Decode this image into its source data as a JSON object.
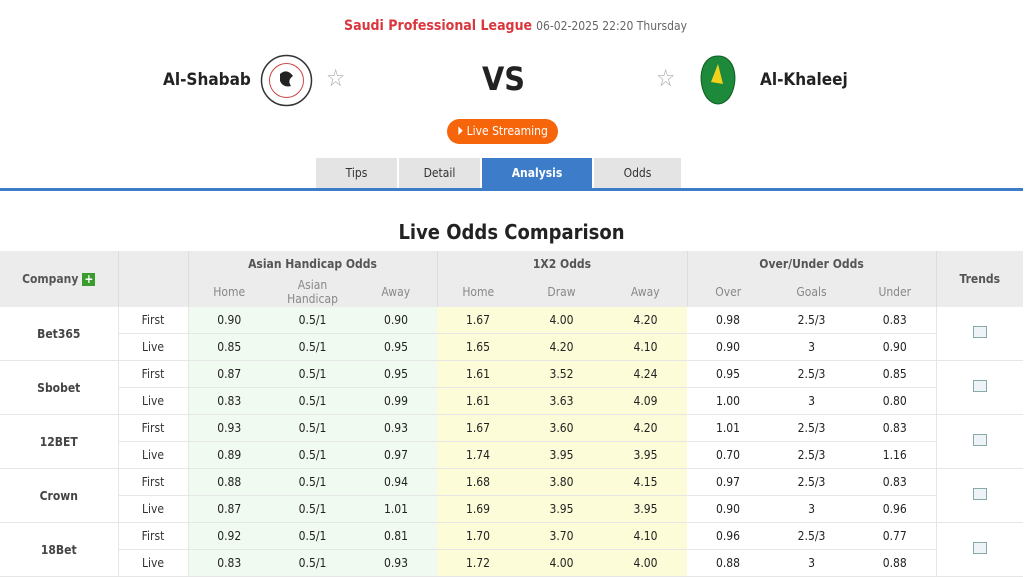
{
  "header": {
    "league": "Saudi Professional League",
    "datetime": "06-02-2025 22:20 Thursday",
    "home_team": "Al-Shabab",
    "away_team": "Al-Khaleej",
    "vs": "VS",
    "live_label": "Live Streaming",
    "icons": [
      "play-icon",
      "star-icon",
      "trend-chart-icon",
      "plus-icon"
    ]
  },
  "tabs": [
    "Tips",
    "Detail",
    "Analysis",
    "Odds"
  ],
  "active_tab": "Analysis",
  "section_title": "Live Odds Comparison",
  "table": {
    "company_header": "Company",
    "groups": [
      "Asian Handicap Odds",
      "1X2 Odds",
      "Over/Under Odds"
    ],
    "trends_header": "Trends",
    "subheaders": [
      "Home",
      "Asian Handicap",
      "Away",
      "Home",
      "Draw",
      "Away",
      "Over",
      "Goals",
      "Under"
    ],
    "companies": [
      {
        "name": "Bet365",
        "rows": [
          [
            "First",
            "0.90",
            "0.5/1",
            "0.90",
            "1.67",
            "4.00",
            "4.20",
            "0.98",
            "2.5/3",
            "0.83"
          ],
          [
            "Live",
            "0.85",
            "0.5/1",
            "0.95",
            "1.65",
            "4.20",
            "4.10",
            "0.90",
            "3",
            "0.90"
          ]
        ]
      },
      {
        "name": "Sbobet",
        "rows": [
          [
            "First",
            "0.87",
            "0.5/1",
            "0.95",
            "1.61",
            "3.52",
            "4.24",
            "0.95",
            "2.5/3",
            "0.85"
          ],
          [
            "Live",
            "0.83",
            "0.5/1",
            "0.99",
            "1.61",
            "3.63",
            "4.09",
            "1.00",
            "3",
            "0.80"
          ]
        ]
      },
      {
        "name": "12BET",
        "rows": [
          [
            "First",
            "0.93",
            "0.5/1",
            "0.93",
            "1.67",
            "3.60",
            "4.20",
            "1.01",
            "2.5/3",
            "0.83"
          ],
          [
            "Live",
            "0.89",
            "0.5/1",
            "0.97",
            "1.74",
            "3.95",
            "3.95",
            "0.70",
            "2.5/3",
            "1.16"
          ]
        ]
      },
      {
        "name": "Crown",
        "rows": [
          [
            "First",
            "0.88",
            "0.5/1",
            "0.94",
            "1.68",
            "3.80",
            "4.15",
            "0.97",
            "2.5/3",
            "0.83"
          ],
          [
            "Live",
            "0.87",
            "0.5/1",
            "1.01",
            "1.69",
            "3.95",
            "3.95",
            "0.90",
            "3",
            "0.96"
          ]
        ]
      },
      {
        "name": "18Bet",
        "rows": [
          [
            "First",
            "0.92",
            "0.5/1",
            "0.81",
            "1.70",
            "3.70",
            "4.10",
            "0.96",
            "2.5/3",
            "0.77"
          ],
          [
            "Live",
            "0.83",
            "0.5/1",
            "0.93",
            "1.72",
            "4.00",
            "4.00",
            "0.88",
            "3",
            "0.88"
          ]
        ]
      }
    ]
  }
}
